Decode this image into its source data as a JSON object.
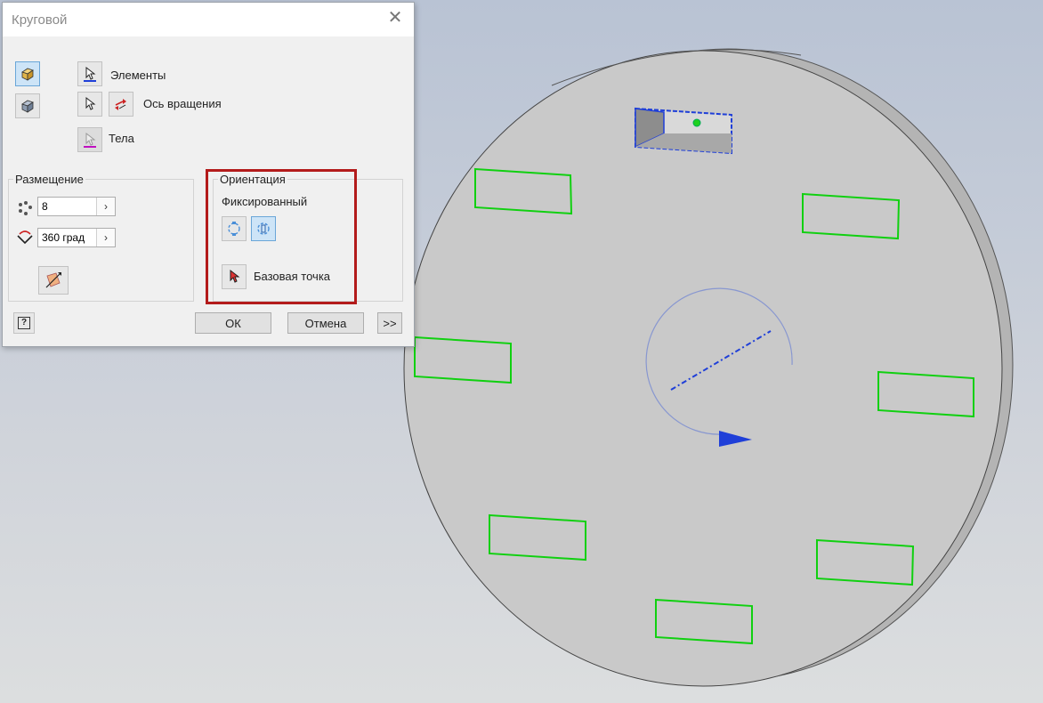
{
  "dialog": {
    "title": "Круговой",
    "close_glyph": "✕",
    "elements_label": "Элементы",
    "axis_label": "Ось вращения",
    "bodies_label": "Тела",
    "placement": {
      "title": "Размещение",
      "count_value": "8",
      "angle_value": "360 град",
      "arrow_glyph": "›"
    },
    "orientation": {
      "title": "Ориентация",
      "fixed_label": "Фиксированный",
      "base_point_label": "Базовая точка"
    },
    "buttons": {
      "ok": "ОК",
      "cancel": "Отмена",
      "more": ">>",
      "help_glyph": "?"
    }
  },
  "viewport": {
    "disc_color": "#c8c8c8",
    "highlight_color": "#00e000",
    "selection_color": "#1f3fd8",
    "axis_color": "#1f3fd8",
    "pattern_count": 8
  }
}
